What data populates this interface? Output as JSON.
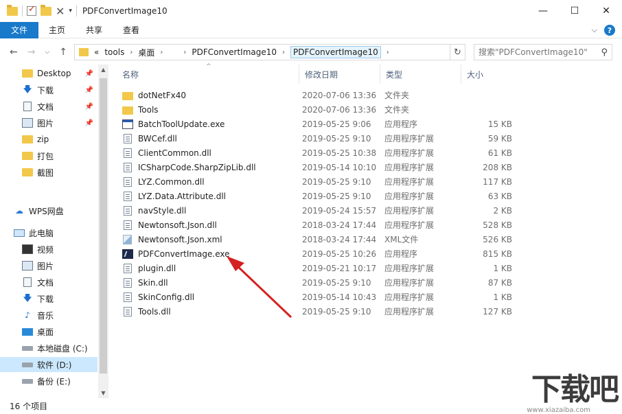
{
  "window": {
    "title": "PDFConvertImage10",
    "controls": {
      "minimize": "—",
      "maximize": "☐",
      "close": "✕"
    }
  },
  "ribbon": {
    "tabs": [
      "文件",
      "主页",
      "共享",
      "查看"
    ],
    "expand": "⌵",
    "help": "?"
  },
  "nav": {
    "back": "←",
    "forward": "→",
    "recent": "⌵",
    "up": "↑"
  },
  "address": {
    "overflow": "«",
    "crumbs": [
      "tools",
      "桌面",
      "PDFConvertImage10",
      "PDFConvertImage10"
    ],
    "refresh": "↻"
  },
  "search": {
    "placeholder": "搜索\"PDFConvertImage10\"",
    "icon": "search-icon"
  },
  "navpane": {
    "items": [
      {
        "label": "Desktop",
        "icon": "folder",
        "pinned": true
      },
      {
        "label": "下载",
        "icon": "download",
        "pinned": true
      },
      {
        "label": "文档",
        "icon": "document",
        "pinned": true
      },
      {
        "label": "图片",
        "icon": "picture",
        "pinned": true
      },
      {
        "label": "zip",
        "icon": "folder",
        "pinned": false
      },
      {
        "label": "打包",
        "icon": "folder",
        "pinned": false
      },
      {
        "label": "截图",
        "icon": "folder",
        "pinned": false
      },
      {
        "label": "WPS网盘",
        "icon": "cloud",
        "pinned": false
      },
      {
        "label": "此电脑",
        "icon": "computer",
        "pinned": false
      },
      {
        "label": "视频",
        "icon": "video",
        "pinned": false
      },
      {
        "label": "图片",
        "icon": "picture",
        "pinned": false
      },
      {
        "label": "文档",
        "icon": "document",
        "pinned": false
      },
      {
        "label": "下载",
        "icon": "download",
        "pinned": false
      },
      {
        "label": "音乐",
        "icon": "music",
        "pinned": false
      },
      {
        "label": "桌面",
        "icon": "desktop",
        "pinned": false
      },
      {
        "label": "本地磁盘 (C:)",
        "icon": "drive",
        "pinned": false
      },
      {
        "label": "软件 (D:)",
        "icon": "drive",
        "pinned": false,
        "selected": true
      },
      {
        "label": "备份 (E:)",
        "icon": "drive",
        "pinned": false
      }
    ]
  },
  "columns": {
    "name": "名称",
    "date": "修改日期",
    "type": "类型",
    "size": "大小"
  },
  "files": [
    {
      "name": "dotNetFx40",
      "date": "2020-07-06 13:36",
      "type": "文件夹",
      "size": "",
      "icon": "folder"
    },
    {
      "name": "Tools",
      "date": "2020-07-06 13:36",
      "type": "文件夹",
      "size": "",
      "icon": "folder"
    },
    {
      "name": "BatchToolUpdate.exe",
      "date": "2019-05-25 9:06",
      "type": "应用程序",
      "size": "15 KB",
      "icon": "exe"
    },
    {
      "name": "BWCef.dll",
      "date": "2019-05-25 9:10",
      "type": "应用程序扩展",
      "size": "59 KB",
      "icon": "dll"
    },
    {
      "name": "ClientCommon.dll",
      "date": "2019-05-25 10:38",
      "type": "应用程序扩展",
      "size": "61 KB",
      "icon": "dll"
    },
    {
      "name": "ICSharpCode.SharpZipLib.dll",
      "date": "2019-05-14 10:10",
      "type": "应用程序扩展",
      "size": "208 KB",
      "icon": "dll"
    },
    {
      "name": "LYZ.Common.dll",
      "date": "2019-05-25 9:10",
      "type": "应用程序扩展",
      "size": "117 KB",
      "icon": "dll"
    },
    {
      "name": "LYZ.Data.Attribute.dll",
      "date": "2019-05-25 9:10",
      "type": "应用程序扩展",
      "size": "63 KB",
      "icon": "dll"
    },
    {
      "name": "navStyle.dll",
      "date": "2019-05-24 15:57",
      "type": "应用程序扩展",
      "size": "2 KB",
      "icon": "dll"
    },
    {
      "name": "Newtonsoft.Json.dll",
      "date": "2018-03-24 17:44",
      "type": "应用程序扩展",
      "size": "528 KB",
      "icon": "dll"
    },
    {
      "name": "Newtonsoft.Json.xml",
      "date": "2018-03-24 17:44",
      "type": "XML文件",
      "size": "526 KB",
      "icon": "xml"
    },
    {
      "name": "PDFConvertImage.exe",
      "date": "2019-05-25 10:26",
      "type": "应用程序",
      "size": "815 KB",
      "icon": "pdfexe"
    },
    {
      "name": "plugin.dll",
      "date": "2019-05-21 10:17",
      "type": "应用程序扩展",
      "size": "1 KB",
      "icon": "dll"
    },
    {
      "name": "Skin.dll",
      "date": "2019-05-25 9:10",
      "type": "应用程序扩展",
      "size": "87 KB",
      "icon": "dll"
    },
    {
      "name": "SkinConfig.dll",
      "date": "2019-05-14 10:43",
      "type": "应用程序扩展",
      "size": "1 KB",
      "icon": "dll"
    },
    {
      "name": "Tools.dll",
      "date": "2019-05-25 9:10",
      "type": "应用程序扩展",
      "size": "127 KB",
      "icon": "dll"
    }
  ],
  "status": {
    "count": "16 个项目"
  },
  "watermark": {
    "text": "下载吧",
    "url": "www.xiazaiba.com"
  },
  "colors": {
    "accent": "#1979ca",
    "selection": "#cce8ff",
    "arrow": "#d42121"
  }
}
